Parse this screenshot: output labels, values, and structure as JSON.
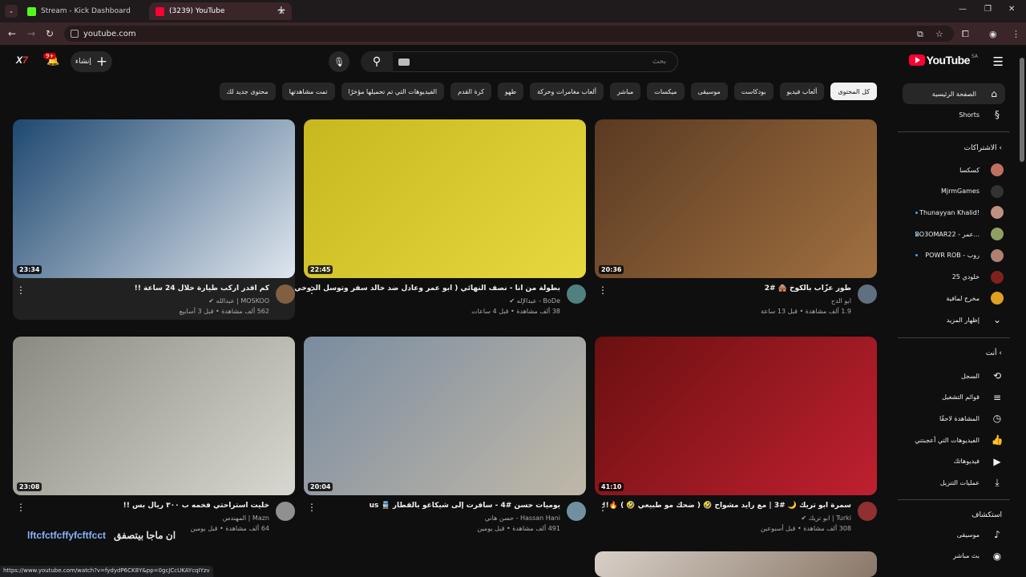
{
  "browser": {
    "tabs": [
      {
        "title": "Stream - Kick Dashboard",
        "color": "#53fc18"
      },
      {
        "title": "(3239) YouTube",
        "color": "#ff0033"
      }
    ],
    "url": "youtube.com",
    "status_url": "https://www.youtube.com/watch?v=fydydP6CK8Y&pp=0gcJCcUKAYcqIYzv"
  },
  "header": {
    "logo": "YouTube",
    "region": "SA",
    "search_placeholder": "بحث",
    "create_label": "إنشاء",
    "notif_count": "9+",
    "avatar": "X7"
  },
  "chips": [
    "كل المحتوى",
    "ألعاب فيديو",
    "بودكاست",
    "موسيقى",
    "ميكسات",
    "مباشر",
    "ألعاب مغامرات وحركة",
    "طهو",
    "كرة القدم",
    "الفيديوهات التي تم تحميلها مؤخرًا",
    "تمت مشاهدتها",
    "محتوى جديد لك"
  ],
  "sidebar": {
    "home": "الصفحة الرئيسية",
    "shorts": "Shorts",
    "subscriptions_head": "الاشتراكات",
    "subs": [
      {
        "name": "كسكسا",
        "color": "#c07060",
        "dot": false
      },
      {
        "name": "MjrmGames",
        "color": "#333333",
        "dot": false
      },
      {
        "name": "Thunayyan Khalid!",
        "color": "#c09080",
        "dot": true
      },
      {
        "name": "BO3OMAR22 - عمر...",
        "color": "#90a060",
        "dot": true
      },
      {
        "name": "POWR ROB - روب",
        "color": "#b08070",
        "dot": true
      },
      {
        "name": "خلودي 25",
        "color": "#802020",
        "dot": false
      },
      {
        "name": "مخرج لمافية",
        "color": "#e0a020",
        "dot": false
      }
    ],
    "show_more": "إظهار المزيد",
    "you_head": "أنت",
    "you_items": [
      {
        "label": "السجل",
        "icon": "history-icon",
        "glyph": "⟲"
      },
      {
        "label": "قوائم التشغيل",
        "icon": "playlist-icon",
        "glyph": "≡"
      },
      {
        "label": "المشاهدة لاحقًا",
        "icon": "clock-icon",
        "glyph": "◷"
      },
      {
        "label": "الفيديوهات التي أعجبتني",
        "icon": "thumb-up-icon",
        "glyph": "👍"
      },
      {
        "label": "فيديوهاتك",
        "icon": "video-icon",
        "glyph": "▶"
      },
      {
        "label": "عمليات التنزيل",
        "icon": "download-icon",
        "glyph": "⤓"
      }
    ],
    "explore_head": "استكشاف",
    "explore_items": [
      {
        "label": "موسيقى",
        "icon": "music-icon",
        "glyph": "♪"
      },
      {
        "label": "بث مباشر",
        "icon": "live-icon",
        "glyph": "◉"
      }
    ]
  },
  "videos": [
    {
      "duration": "20:36",
      "title": "طور عزّاب بالكوخ 🛖 #2",
      "channel": "ابو الدح",
      "verified": false,
      "views": "1.9 ألف مشاهدة",
      "age": "قبل 13 ساعة",
      "thumb_a": "#5a3a22",
      "thumb_b": "#a07040",
      "av": "#607080"
    },
    {
      "duration": "22:45",
      "title": "بطولة من انا - نصف النهائي ( ابو عمر وعادل ضد خالد سفر وتوسل الدوخي )",
      "channel": "BoDe - عبدالإله",
      "verified": true,
      "views": "38 ألف مشاهدة",
      "age": "قبل 4 ساعات",
      "thumb_a": "#c8b820",
      "thumb_b": "#e8d840",
      "av": "#508080"
    },
    {
      "duration": "23:34",
      "title": "كم اقدر اركب طيارة خلال 24 ساعة !!",
      "channel": "MOSKOO | عبدالله",
      "verified": true,
      "views": "562 ألف مشاهدة",
      "age": "قبل 3 أسابيع",
      "thumb_a": "#1e4870",
      "thumb_b": "#dfe6ee",
      "av": "#806040"
    },
    {
      "duration": "41:10",
      "title": "سمرة ابو تريك 🌙 #3 | مع رايد مشواح 🤣 ( ضحك مو طبيعي 🤣 ) 🔥!!",
      "channel": "Turki | ابو تريك",
      "verified": true,
      "views": "308 ألف مشاهدة",
      "age": "قبل أسبوعين",
      "thumb_a": "#6a1010",
      "thumb_b": "#c02030",
      "av": "#903030"
    },
    {
      "duration": "20:04",
      "title": "يوميات حسن #4 - سافرت إلى شيكاغو بالقطار 🚆 us",
      "channel": "Hassan Hani - حسن هاني",
      "verified": false,
      "views": "491 ألف مشاهدة",
      "age": "قبل يومين",
      "thumb_a": "#7a8ca0",
      "thumb_b": "#c0b8a8",
      "av": "#7090a0"
    },
    {
      "duration": "23:08",
      "title": "خليت استراحتي فخمه ب ٣٠٠ ريال بس !!",
      "channel": "Mazn | المهندس",
      "verified": false,
      "views": "64 ألف مشاهدة",
      "age": "قبل يومين",
      "thumb_a": "#8a8a80",
      "thumb_b": "#d8d8d0",
      "av": "#909090"
    }
  ],
  "overlay": {
    "blue": "lftcfctfcffyfcftfcct",
    "white": "ان ماجا بيتصفق"
  }
}
